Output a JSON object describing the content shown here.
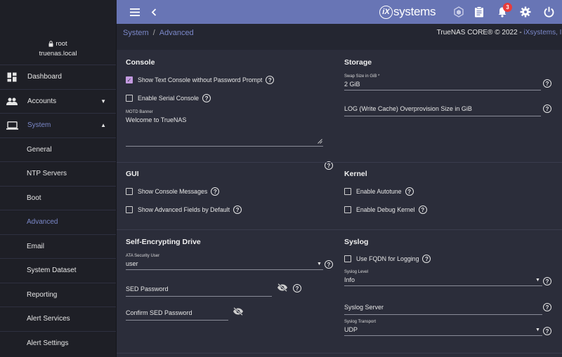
{
  "topbar": {
    "menu_icon": "hamburger-menu-icon",
    "back_icon": "chevron-left-icon",
    "logo_mark": "iX",
    "logo_text": "systems",
    "notification_count": "3",
    "icons": [
      "truecommand-icon",
      "clipboard-icon",
      "bell-icon",
      "gear-icon",
      "power-icon"
    ]
  },
  "sidebar": {
    "user": "root",
    "host": "truenas.local",
    "items": [
      {
        "label": "Dashboard",
        "icon": "dashboard-icon"
      },
      {
        "label": "Accounts",
        "icon": "accounts-icon"
      },
      {
        "label": "System",
        "icon": "laptop-icon"
      },
      {
        "label": "General"
      },
      {
        "label": "NTP Servers"
      },
      {
        "label": "Boot"
      },
      {
        "label": "Advanced"
      },
      {
        "label": "Email"
      },
      {
        "label": "System Dataset"
      },
      {
        "label": "Reporting"
      },
      {
        "label": "Alert Services"
      },
      {
        "label": "Alert Settings"
      }
    ]
  },
  "breadcrumb": {
    "parent": "System",
    "separator": "/",
    "current": "Advanced"
  },
  "copyright": {
    "product": "TrueNAS CORE® © 2022 - ",
    "company": "iXsystems, Inc"
  },
  "console": {
    "title": "Console",
    "show_text_console": "Show Text Console without Password Prompt",
    "enable_serial": "Enable Serial Console",
    "motd_label": "MOTD Banner",
    "motd_value": "Welcome to TrueNAS"
  },
  "storage": {
    "title": "Storage",
    "swap_label": "Swap Size in GiB *",
    "swap_value": "2 GiB",
    "log_label": "LOG (Write Cache) Overprovision Size in GiB"
  },
  "gui": {
    "title": "GUI",
    "show_console_messages": "Show Console Messages",
    "show_advanced_fields": "Show Advanced Fields by Default"
  },
  "kernel": {
    "title": "Kernel",
    "enable_autotune": "Enable Autotune",
    "enable_debug_kernel": "Enable Debug Kernel"
  },
  "sed": {
    "title": "Self-Encrypting Drive",
    "ata_label": "ATA Security User",
    "ata_value": "user",
    "sed_password": "SED Password",
    "confirm_sed_password": "Confirm SED Password"
  },
  "syslog": {
    "title": "Syslog",
    "use_fqdn": "Use FQDN for Logging",
    "level_label": "Syslog Level",
    "level_value": "Info",
    "server_label": "Syslog Server",
    "transport_label": "Syslog Transport",
    "transport_value": "UDP"
  },
  "colors": {
    "header": "#6875b5",
    "sidebar": "#1e1f26",
    "card": "#2b2d3a",
    "accent": "#7b88c9",
    "checkbox_checked": "#c39ae0",
    "badge": "#e83b3b"
  }
}
